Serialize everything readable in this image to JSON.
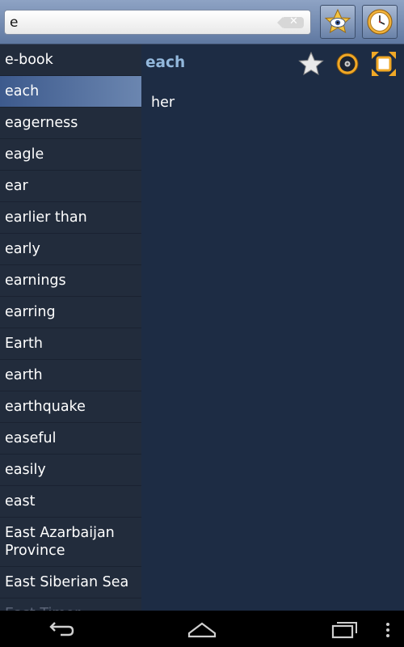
{
  "search": {
    "value": "e",
    "clear_label": "✕"
  },
  "toolbar": {
    "favorites_icon": "star-eye-icon",
    "history_icon": "clock-icon"
  },
  "word_list": [
    {
      "label": "e-book"
    },
    {
      "label": "each"
    },
    {
      "label": "eagerness"
    },
    {
      "label": "eagle"
    },
    {
      "label": "ear"
    },
    {
      "label": "earlier than"
    },
    {
      "label": "early"
    },
    {
      "label": "earnings"
    },
    {
      "label": "earring"
    },
    {
      "label": "Earth"
    },
    {
      "label": "earth"
    },
    {
      "label": "earthquake"
    },
    {
      "label": "easeful"
    },
    {
      "label": "easily"
    },
    {
      "label": "east"
    },
    {
      "label": "East Azarbaijan Province"
    },
    {
      "label": "East Siberian Sea"
    },
    {
      "label": "East Timor"
    }
  ],
  "selected_index": 1,
  "detail": {
    "headword": "each",
    "translation": "her"
  },
  "colors": {
    "accent": "#93b8dc",
    "selected_row": "#4a6699",
    "list_bg": "#222c3c",
    "detail_bg": "#1d2c44"
  },
  "navbar": {
    "back_icon": "back-icon",
    "home_icon": "home-icon",
    "recents_icon": "recents-icon",
    "menu_icon": "menu-icon"
  }
}
